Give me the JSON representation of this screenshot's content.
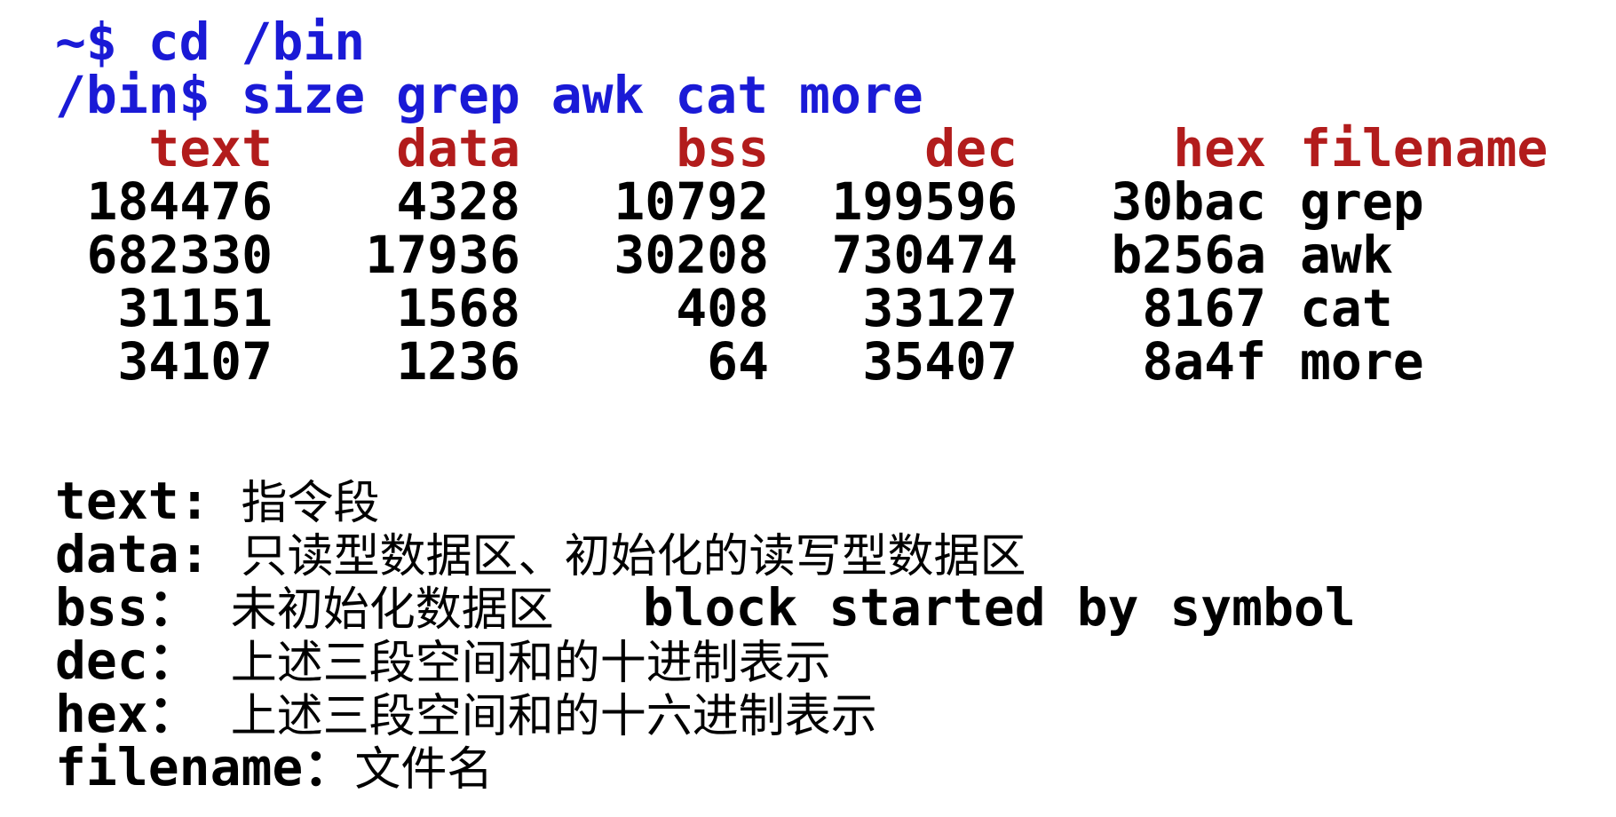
{
  "terminal": {
    "commands": [
      {
        "prompt": "~$ ",
        "command": "cd /bin"
      },
      {
        "prompt": "/bin$ ",
        "command": "size grep awk cat more"
      }
    ],
    "table": {
      "headers": [
        "text",
        "data",
        "bss",
        "dec",
        "hex",
        "filename"
      ],
      "rows": [
        [
          "184476",
          "4328",
          "10792",
          "199596",
          "30bac",
          "grep"
        ],
        [
          "682330",
          "17936",
          "30208",
          "730474",
          "b256a",
          "awk"
        ],
        [
          "31151",
          "1568",
          "408",
          "33127",
          "8167",
          "cat"
        ],
        [
          "34107",
          "1236",
          "64",
          "35407",
          "8a4f",
          "more"
        ]
      ]
    }
  },
  "legend": [
    {
      "term": "text:",
      "desc": "指令段",
      "extra": ""
    },
    {
      "term": "data:",
      "desc": "只读型数据区、初始化的读写型数据区",
      "extra": ""
    },
    {
      "term": "bss：",
      "desc": "未初始化数据区",
      "extra": "block started by symbol"
    },
    {
      "term": "dec：",
      "desc": "上述三段空间和的十进制表示",
      "extra": ""
    },
    {
      "term": "hex：",
      "desc": "上述三段空间和的十六进制表示",
      "extra": ""
    },
    {
      "term": "filename：",
      "desc": "文件名",
      "extra": ""
    }
  ],
  "colors": {
    "command": "#1a1ad6",
    "header": "#b21c1c",
    "text": "#000000",
    "background": "#ffffff"
  }
}
